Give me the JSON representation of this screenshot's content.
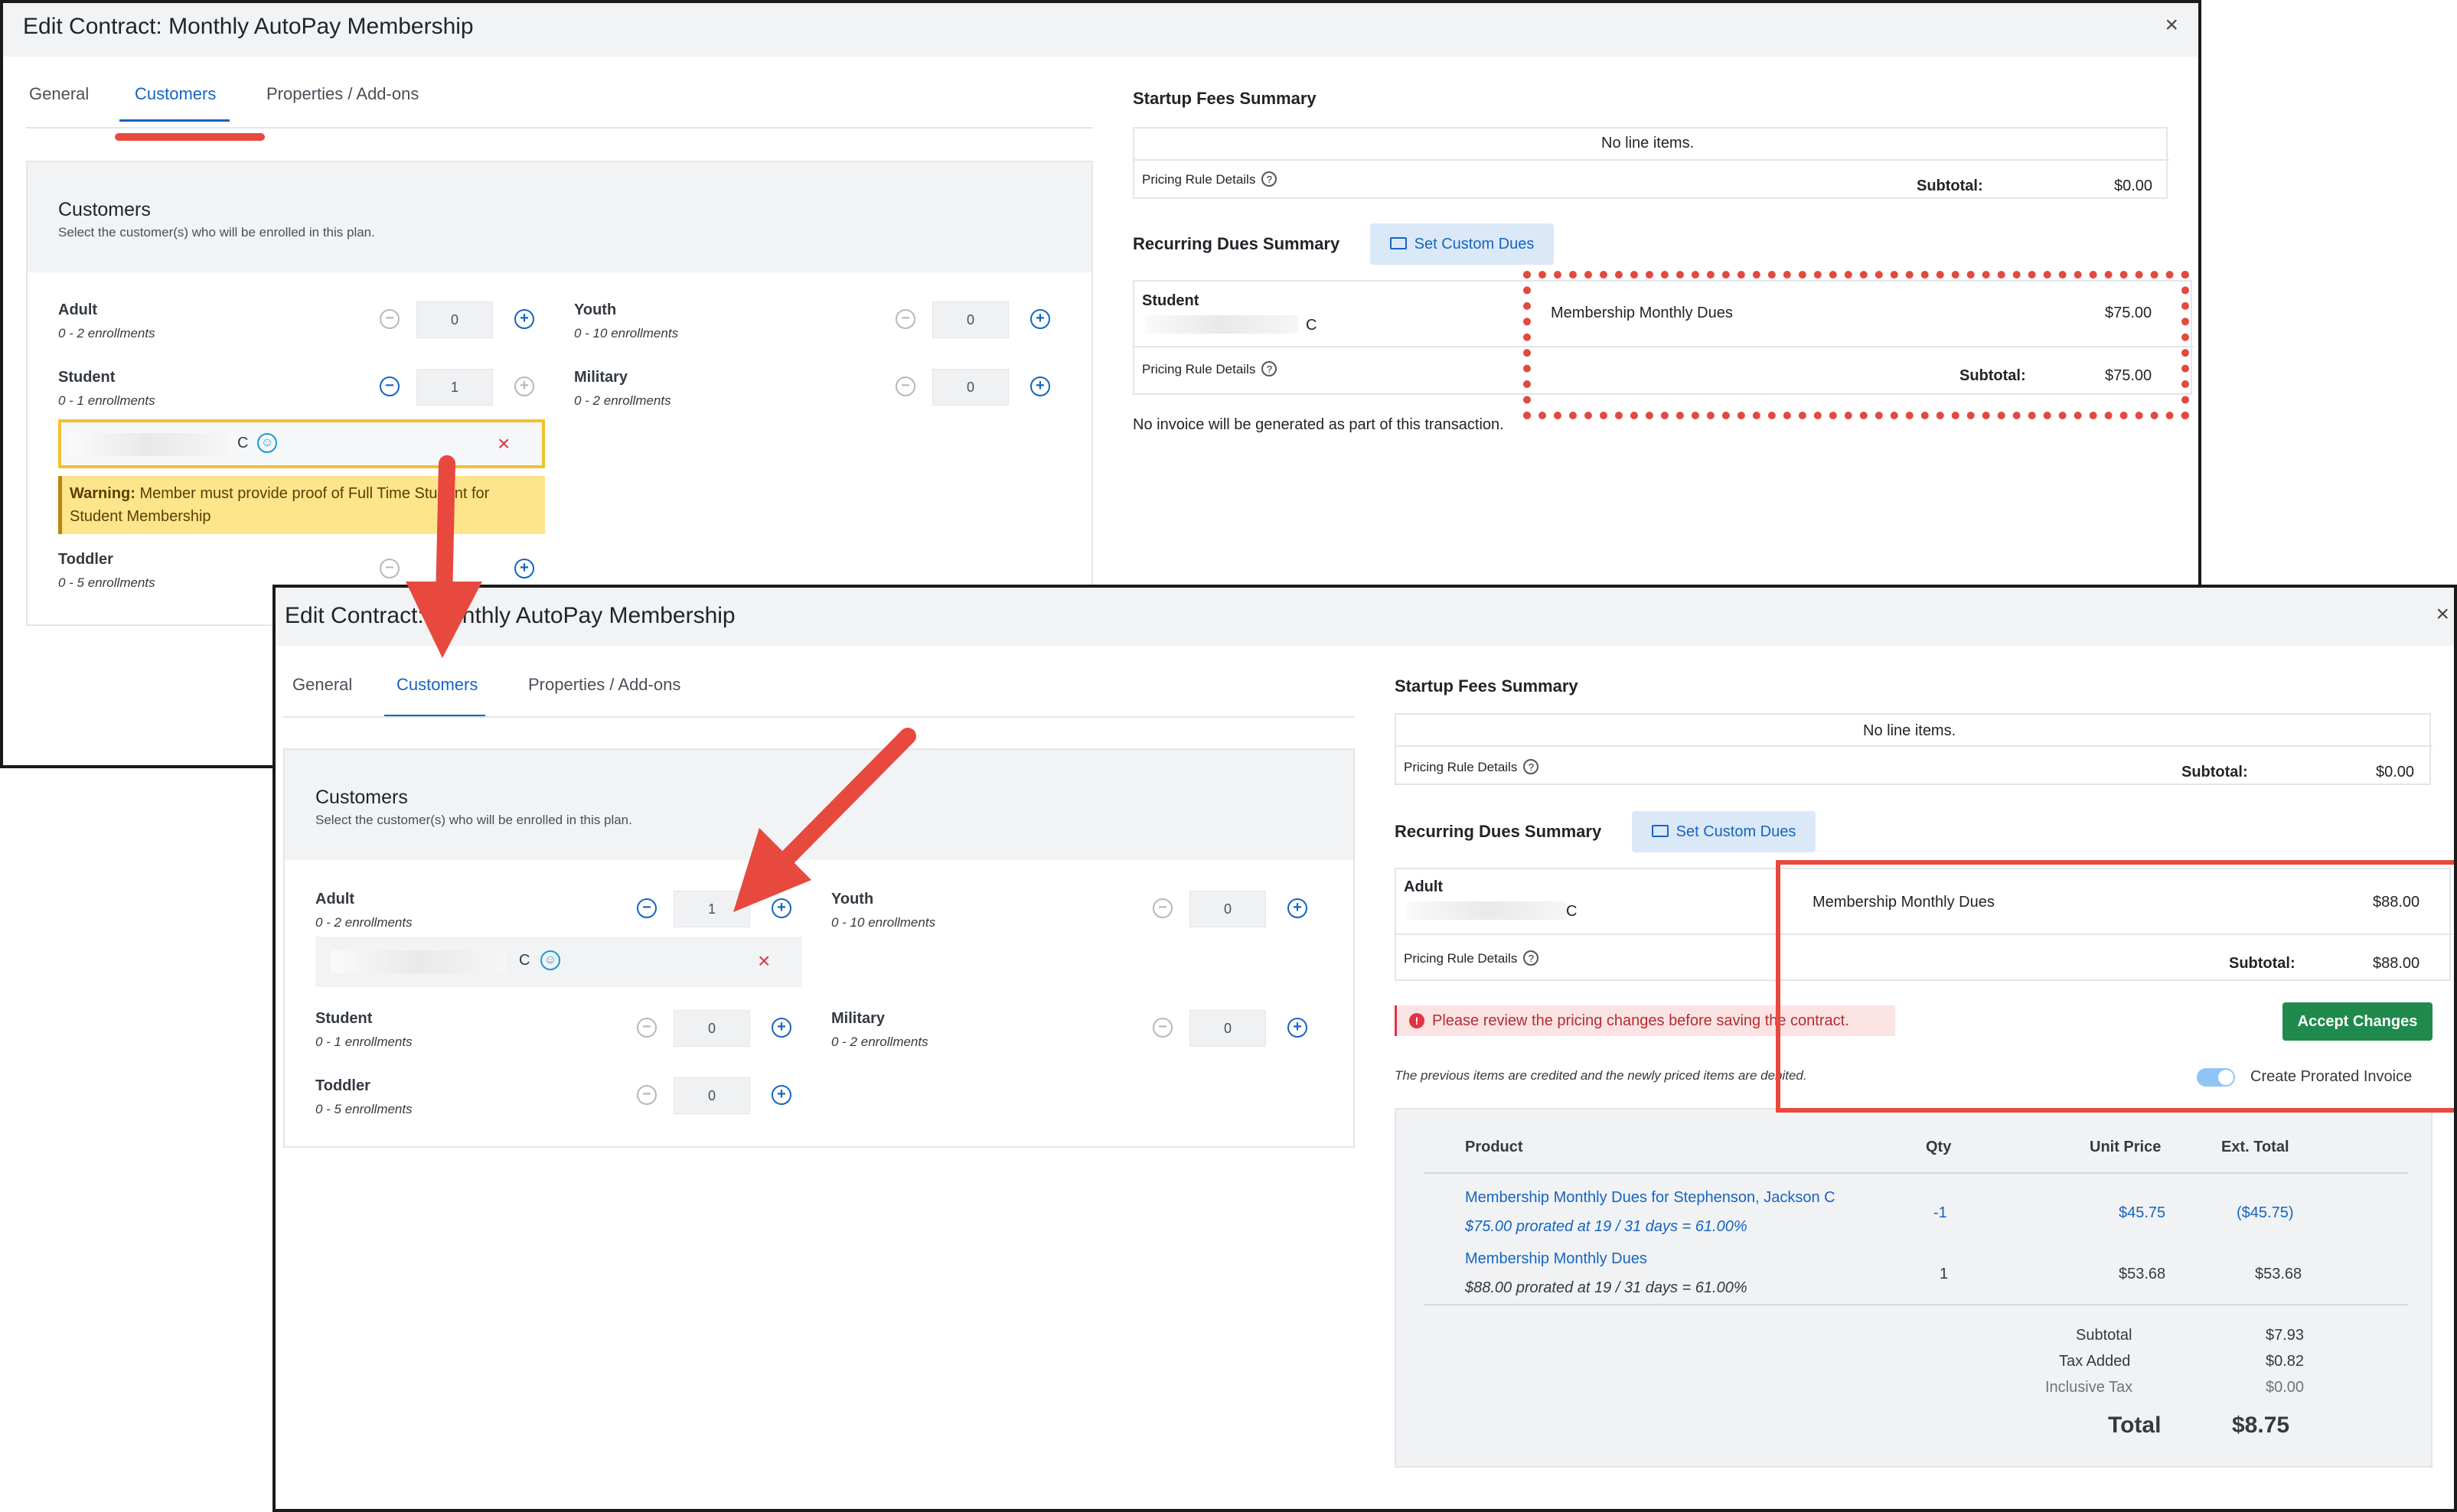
{
  "top_window": {
    "title": "Edit Contract: Monthly AutoPay Membership",
    "close_glyph": "×",
    "tabs": [
      "General",
      "Customers",
      "Properties / Add-ons"
    ],
    "customers_panel": {
      "title": "Customers",
      "subtitle": "Select the customer(s) who will be enrolled in this plan.",
      "types": [
        {
          "label": "Adult",
          "range": "0 - 2 enrollments",
          "count": "0"
        },
        {
          "label": "Youth",
          "range": "0 - 10 enrollments",
          "count": "0"
        },
        {
          "label": "Student",
          "range": "0 - 1 enrollments",
          "count": "1"
        },
        {
          "label": "Military",
          "range": "0 - 2 enrollments",
          "count": "0"
        },
        {
          "label": "Toddler",
          "range": "0 - 5 enrollments"
        }
      ],
      "selected_initial": "C",
      "warning_prefix": "Warning:",
      "warning_text": "Member must provide proof of Full Time Student for Student Membership"
    },
    "startup": {
      "title": "Startup Fees Summary",
      "no_items": "No line items.",
      "pricing_rule": "Pricing Rule Details",
      "subtotal_label": "Subtotal:",
      "subtotal_value": "$0.00"
    },
    "recurring": {
      "title": "Recurring Dues Summary",
      "custom_dues_button": "Set Custom Dues",
      "customer_type": "Student",
      "customer_initial": "C",
      "pricing_rule": "Pricing Rule Details",
      "item": "Membership Monthly Dues",
      "item_price": "$75.00",
      "subtotal_label": "Subtotal:",
      "subtotal_value": "$75.00",
      "note": "No invoice will be generated as part of this transaction."
    }
  },
  "bottom_window": {
    "title": "Edit Contract: Monthly AutoPay Membership",
    "close_glyph": "×",
    "tabs": [
      "General",
      "Customers",
      "Properties / Add-ons"
    ],
    "customers_panel": {
      "title": "Customers",
      "subtitle": "Select the customer(s) who will be enrolled in this plan.",
      "types": [
        {
          "label": "Adult",
          "range": "0 - 2 enrollments",
          "count": "1"
        },
        {
          "label": "Youth",
          "range": "0 - 10 enrollments",
          "count": "0"
        },
        {
          "label": "Student",
          "range": "0 - 1 enrollments",
          "count": "0"
        },
        {
          "label": "Military",
          "range": "0 - 2 enrollments",
          "count": "0"
        },
        {
          "label": "Toddler",
          "range": "0 - 5 enrollments",
          "count": "0"
        }
      ],
      "selected_initial": "C"
    },
    "startup": {
      "title": "Startup Fees Summary",
      "no_items": "No line items.",
      "pricing_rule": "Pricing Rule Details",
      "subtotal_label": "Subtotal:",
      "subtotal_value": "$0.00"
    },
    "recurring": {
      "title": "Recurring Dues Summary",
      "custom_dues_button": "Set Custom Dues",
      "customer_type": "Adult",
      "customer_initial": "C",
      "pricing_rule": "Pricing Rule Details",
      "item": "Membership Monthly Dues",
      "item_price": "$88.00",
      "subtotal_label": "Subtotal:",
      "subtotal_value": "$88.00"
    },
    "alert": "Please review the pricing changes before saving the contract.",
    "accept_button": "Accept Changes",
    "credit_note": "The previous items are credited and the newly priced items are debited.",
    "prorated_toggle_label": "Create Prorated Invoice",
    "invoice": {
      "columns": [
        "Product",
        "Qty",
        "Unit Price",
        "Ext. Total"
      ],
      "rows": [
        {
          "product": "Membership Monthly Dues for Stephenson, Jackson C",
          "detail": "$75.00 prorated at 19 / 31 days = 61.00%",
          "qty": "-1",
          "unit_price": "$45.75",
          "ext_total": "($45.75)"
        },
        {
          "product": "Membership Monthly Dues",
          "detail": "$88.00 prorated at 19 / 31 days = 61.00%",
          "qty": "1",
          "unit_price": "$53.68",
          "ext_total": "$53.68"
        }
      ],
      "subtotal_label": "Subtotal",
      "subtotal_value": "$7.93",
      "tax_label": "Tax Added",
      "tax_value": "$0.82",
      "inclusive_tax_label": "Inclusive Tax",
      "inclusive_tax_value": "$0.00",
      "total_label": "Total",
      "total_value": "$8.75"
    }
  },
  "colors": {
    "accent_blue": "#1565c0",
    "annotation_red": "#e8493e",
    "accept_green": "#1f8a4c",
    "warning_yellow": "#fde58c"
  }
}
